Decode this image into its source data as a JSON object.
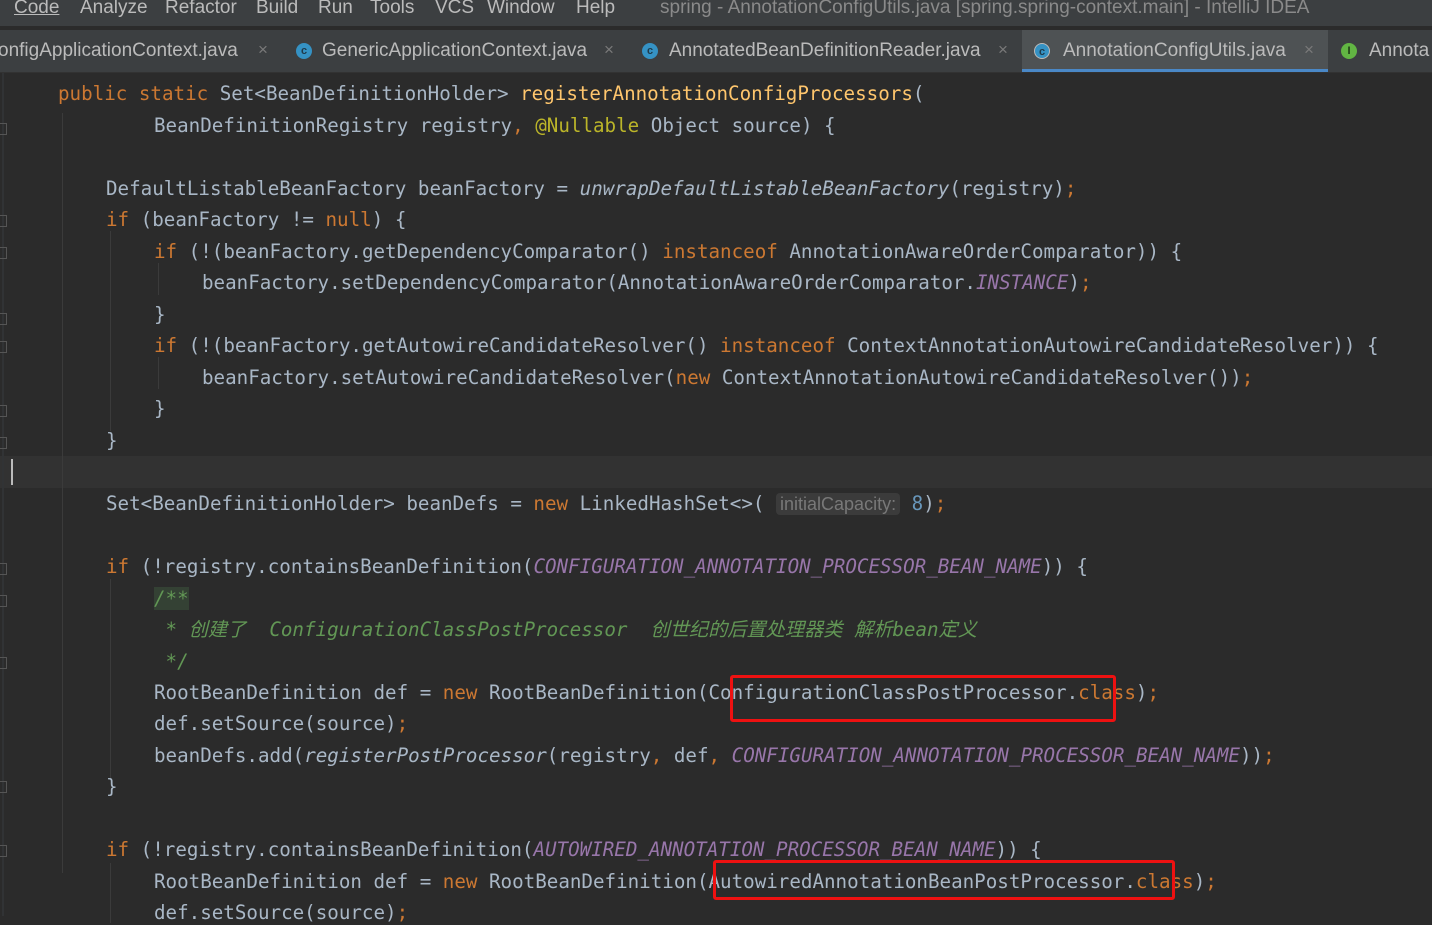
{
  "menu": [
    "Code",
    "Analyze",
    "Refactor",
    "Build",
    "Run",
    "Tools",
    "VCS",
    "Window",
    "Help"
  ],
  "window_title": "spring - AnnotationConfigUtils.java [spring.spring-context.main] - IntelliJ IDEA",
  "tabs": [
    {
      "label": "onfigApplicationContext.java",
      "icon": "class-icon"
    },
    {
      "label": "GenericApplicationContext.java",
      "icon": "class-icon"
    },
    {
      "label": "AnnotatedBeanDefinitionReader.java",
      "icon": "class-icon"
    },
    {
      "label": "AnnotationConfigUtils.java",
      "icon": "class-icon",
      "selected": true
    },
    {
      "label": "Annota",
      "icon": "interface-icon"
    }
  ],
  "tab_close_glyph": "×",
  "icon_glyphs": {
    "class": "c",
    "interface": "I"
  },
  "code": {
    "l1": {
      "public": "public",
      "static": "static",
      "type": "Set<BeanDefinitionHolder>",
      "name": "registerAnnotationConfigProcessors",
      "paren": "("
    },
    "l2": {
      "p1": "BeanDefinitionRegistry registry",
      "comma": ",",
      "ann": "@Nullable",
      "p2": "Object source) {"
    },
    "l3": {
      "a": "DefaultListableBeanFactory beanFactory = ",
      "call": "unwrapDefaultListableBeanFactory",
      "b": "(registry)",
      "semi": ";"
    },
    "l4": {
      "if": "if",
      "a": " (beanFactory != ",
      "null": "null",
      "b": ") {"
    },
    "l5": {
      "if": "if",
      "a": " (!(beanFactory.getDependencyComparator() ",
      "instanceof": "instanceof",
      "b": " AnnotationAwareOrderComparator)) {"
    },
    "l6": {
      "a": "beanFactory.setDependencyComparator(AnnotationAwareOrderComparator.",
      "cst": "INSTANCE",
      "b": ")",
      "semi": ";"
    },
    "brace_close": "}",
    "l8": {
      "if": "if",
      "a": " (!(beanFactory.getAutowireCandidateResolver() ",
      "instanceof": "instanceof",
      "b": " ContextAnnotationAutowireCandidateResolver)) {"
    },
    "l9": {
      "a": "beanFactory.setAutowireCandidateResolver(",
      "new": "new",
      "b": " ContextAnnotationAutowireCandidateResolver())",
      "semi": ";"
    },
    "l12": {
      "a": "Set<BeanDefinitionHolder> beanDefs = ",
      "new": "new",
      "b": " LinkedHashSet<>( ",
      "hint": "initialCapacity:",
      "num": "8",
      "c": ")",
      "semi": ";"
    },
    "l13": {
      "if": "if",
      "a": " (!registry.containsBeanDefinition(",
      "cst": "CONFIGURATION_ANNOTATION_PROCESSOR_BEAN_NAME",
      "b": ")) {"
    },
    "l14": "/**",
    "l15": " * 创建了  ConfigurationClassPostProcessor  创世纪的后置处理器类 解析bean定义",
    "l16": " */",
    "l17": {
      "a": "RootBeanDefinition def = ",
      "new": "new",
      "b": " RootBeanDefinition(ConfigurationClassPostProcessor.",
      "class": "class",
      "c": ")",
      "semi": ";"
    },
    "l18": {
      "a": "def.setSource(source)",
      "semi": ";"
    },
    "l19": {
      "a": "beanDefs.add(",
      "call": "registerPostProcessor",
      "b": "(registry",
      "comma": ",",
      "c": " def",
      "comma2": ",",
      "cst": "CONFIGURATION_ANNOTATION_PROCESSOR_BEAN_NAME",
      "d": "))",
      "semi": ";"
    },
    "l21": {
      "if": "if",
      "a": " (!registry.containsBeanDefinition(",
      "cst": "AUTOWIRED_ANNOTATION_PROCESSOR_BEAN_NAME",
      "b": ")) {"
    },
    "l22": {
      "a": "RootBeanDefinition def = ",
      "new": "new",
      "b": " RootBeanDefinition(AutowiredAnnotationBeanPostProcessor.",
      "class": "class",
      "c": ")",
      "semi": ";"
    },
    "l23": {
      "a": "def.setSource(source)",
      "semi": ";"
    }
  },
  "colors": {
    "background": "#2b2b2b",
    "keyword": "#cc7832",
    "method": "#ffc66d",
    "constant": "#9876aa",
    "comment": "#629755",
    "highlight": "#ee1111"
  }
}
